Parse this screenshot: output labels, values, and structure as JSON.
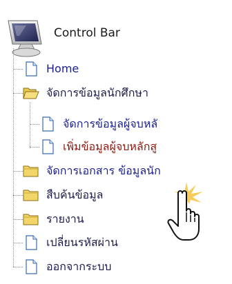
{
  "header": {
    "title": "Control Bar",
    "icon": "monitor-icon"
  },
  "menu": [
    {
      "label": "Home",
      "icon": "page-icon",
      "color": "#1a1f8c"
    },
    {
      "label": "จัดการข้อมูลนักศึกษา",
      "icon": "folder-open-icon",
      "color": "#1c1c4a",
      "children": [
        {
          "label": "จัดการข้อมูลผู้จบหลั",
          "icon": "page-icon",
          "color": "#1a1f8c"
        },
        {
          "label": "เพิ่มข้อมูลผู้จบหลักสู",
          "icon": "page-icon",
          "color": "#8b1a10"
        }
      ]
    },
    {
      "label": "จัดการเอกสาร ข้อมูลนัก",
      "icon": "folder-icon",
      "color": "#1a1f8c"
    },
    {
      "label": "สืบค้นข้อมูล",
      "icon": "folder-icon",
      "color": "#1c1c4a"
    },
    {
      "label": "รายงาน",
      "icon": "folder-icon",
      "color": "#1c1c4a"
    },
    {
      "label": "เปลี่ยนรหัสผ่าน",
      "icon": "page-icon",
      "color": "#1c1c4a"
    },
    {
      "label": "ออกจากระบบ",
      "icon": "page-icon",
      "color": "#1c1c4a"
    }
  ],
  "cursor": "hand-pointer-icon"
}
